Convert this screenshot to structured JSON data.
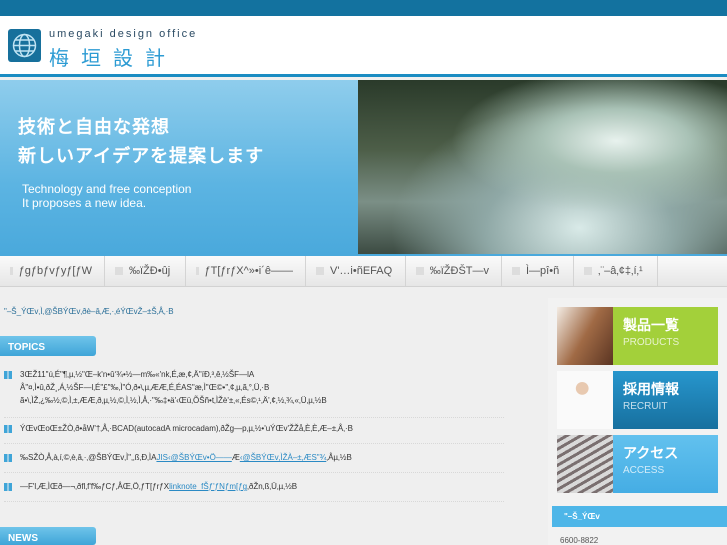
{
  "header": {
    "logo_en": "umegaki design office",
    "logo_jp": "梅垣設計"
  },
  "hero": {
    "jp_line1": "技術と自由な発想",
    "jp_line2": "新しいアイデアを提案します",
    "en_line1": "Technology and free conception",
    "en_line2": "It proposes a new idea."
  },
  "nav": [
    "ƒgƒbƒvƒyƒ[ƒW",
    "‰ïŽÐ•ûj",
    "ƒT[ƒrƒX^»•i´ê——",
    "V'…i•ñEFAQ",
    "‰ïŽÐŠT—v",
    "Ì—pî•ñ",
    "‚¨–â‚¢‡‚í‚¹"
  ],
  "intro": "\"–Š_ÝŒv‚Ì‚@ŠBÝŒv‚ðè–â‚Æ‚·‚éÝŒvŽ–±Š‚Å‚·B",
  "topics": {
    "heading": "TOPICS",
    "items": [
      {
        "lines": [
          "3ŒŽ11\"ú‚É\"¶‚µ‚½\"Œ–k'n•û‘¾•½—m‰«'nk‚É‚æ‚¢‚Ä\"íÐ‚³‚ê‚½ŠF—lA",
          "Å\"¤‚Ì•û‚ðŽ¸‚Á‚½ŠF—l‚É\"£\"‰‚Ì\"Ó‚ð•\\‚µ‚ÆÆ‚É‚ÉAS\"æ‚Ì\"Œ©•\"‚¢‚µ‚ã‚°‚Ü‚·B",
          "ã•\\‚ÌŽ‚¿‰½‚©‚Ì‚±‚ÆÆ‚ð‚µ‚½‚©‚Ì‚½‚Ì‚Å‚·\"‰‡•ä'‹Œü‚ÕŠñ•t‚ÌŽè'±‚«‚És©‚¹‚Ä'‚¢‚½‚¾‚«‚Ü‚µ‚½B"
        ]
      },
      {
        "lines": [
          "ÝŒvŒoŒ±ŽÒ‚ð•åW'†‚Å‚·BCAD(autocadA microcadam)‚ðŽg—p‚µ‚½•'uÝŒv'ŽŽå‚È‚È‚Æ–±‚Å‚·B"
        ]
      },
      {
        "pre": "‰SŽÒ‚Å‚à‚í‚©‚è‚â‚·‚­@ŠBÝŒv‚Ì\"‚‚ß‚Ð‚ÌA",
        "link1": "JIS‹@ŠBÝŒv•Ö——",
        "mid": "Æ",
        "link2": "‹@ŠBÝŒv‚ÌŽÀ–±‚ÆS\"¾",
        "post": "‚Åµ‚½B"
      },
      {
        "pre": "—F'l‚Æ‚ÌŒð—¬‚ðfl‚f'f‰ƒCƒ‚ÅŒ‚Ö‚ƒT[ƒrƒX",
        "link1": "linknote_fŠƒ'ƒNƒm[ƒg",
        "post": "‚ðŽn‚ß‚Ü‚µ‚½B"
      }
    ]
  },
  "news": {
    "heading": "NEWS"
  },
  "sidebar": {
    "banners": [
      {
        "jp": "製品一覧",
        "en": "PRODUCTS",
        "color": "#a3d03a"
      },
      {
        "jp": "採用情報",
        "en": "RECRUIT",
        "color": "#1a86bf"
      },
      {
        "jp": "アクセス",
        "en": "ACCESS",
        "color": "#4db5e8"
      }
    ],
    "contact_heading": "\"–Š_ÝŒv",
    "tel": "6600-8822"
  }
}
